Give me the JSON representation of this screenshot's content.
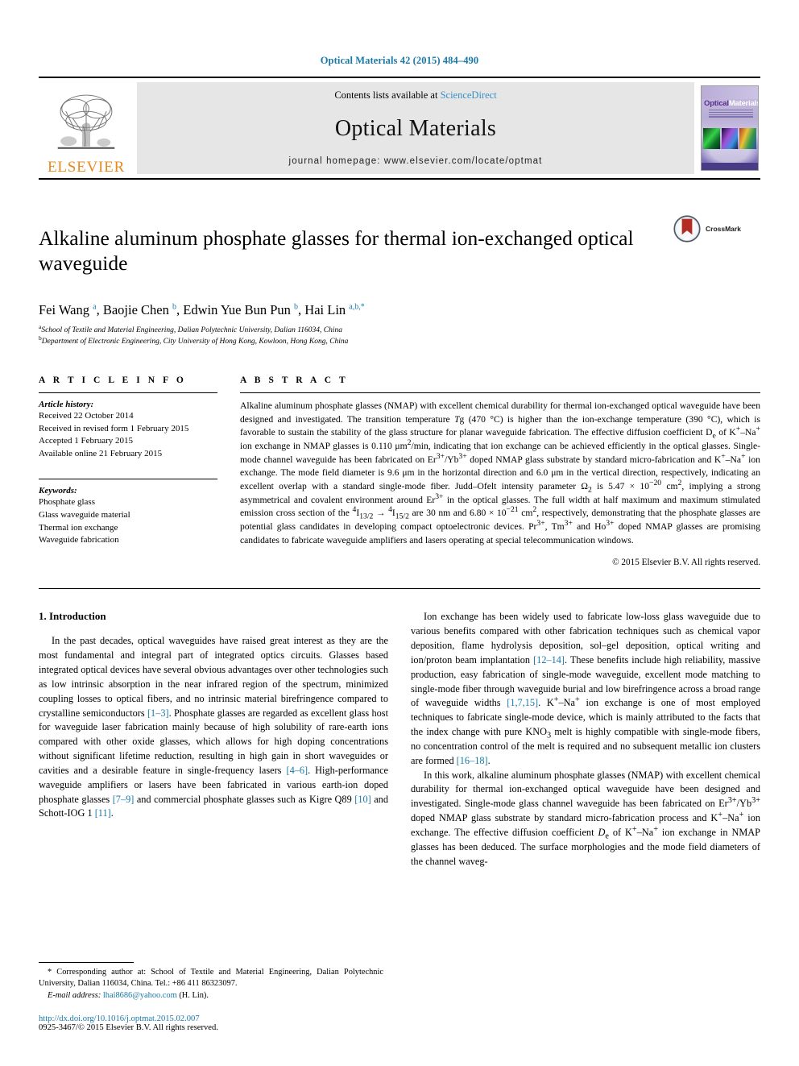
{
  "running_head": "Optical Materials 42 (2015) 484–490",
  "masthead": {
    "publisher_name": "ELSEVIER",
    "contents_prefix": "Contents lists available at ",
    "contents_link": "ScienceDirect",
    "journal_name": "Optical Materials",
    "homepage": "journal homepage: www.elsevier.com/locate/optmat",
    "cover": {
      "title_part1": "Optical",
      "title_part2": "Materials"
    }
  },
  "article": {
    "title": "Alkaline aluminum phosphate glasses for thermal ion-exchanged optical waveguide",
    "crossmark_label": "CrossMark",
    "authors_html": "Fei Wang <sup>a</sup>, Baojie Chen <sup>b</sup>, Edwin Yue Bun Pun <sup>b</sup>, Hai Lin <sup>a,b,</sup><sup>*</sup>",
    "affiliations": [
      "School of Textile and Material Engineering, Dalian Polytechnic University, Dalian 116034, China",
      "Department of Electronic Engineering, City University of Hong Kong, Kowloon, Hong Kong, China"
    ],
    "affiliation_marks": [
      "a",
      "b"
    ]
  },
  "info": {
    "heading": "A R T I C L E   I N F O",
    "history_label": "Article history:",
    "history": [
      "Received 22 October 2014",
      "Received in revised form 1 February 2015",
      "Accepted 1 February 2015",
      "Available online 21 February 2015"
    ],
    "keywords_label": "Keywords:",
    "keywords": [
      "Phosphate glass",
      "Glass waveguide material",
      "Thermal ion exchange",
      "Waveguide fabrication"
    ]
  },
  "abstract": {
    "heading": "A B S T R A C T",
    "body_html": "Alkaline aluminum phosphate glasses (NMAP) with excellent chemical durability for thermal ion-exchanged optical waveguide have been designed and investigated. The transition temperature <i>T</i>g (470&nbsp;°C) is higher than the ion-exchange temperature (390&nbsp;°C), which is favorable to sustain the stability of the glass structure for planar waveguide fabrication. The effective diffusion coefficient D<sub>e</sub> of K<sup>+</sup>–Na<sup>+</sup> ion exchange in NMAP glasses is 0.110 μm<sup>2</sup>/min, indicating that ion exchange can be achieved efficiently in the optical glasses. Single-mode channel waveguide has been fabricated on Er<sup>3+</sup>/Yb<sup>3+</sup> doped NMAP glass substrate by standard micro-fabrication and K<sup>+</sup>–Na<sup>+</sup> ion exchange. The mode field diameter is 9.6 μm in the horizontal direction and 6.0 μm in the vertical direction, respectively, indicating an excellent overlap with a standard single-mode fiber. Judd–Ofelt intensity parameter Ω<sub>2</sub> is 5.47 × 10<sup>−20</sup> cm<sup>2</sup>, implying a strong asymmetrical and covalent environment around Er<sup>3+</sup> in the optical glasses. The full width at half maximum and maximum stimulated emission cross section of the <sup>4</sup>I<sub>13/2</sub> → <sup>4</sup>I<sub>15/2</sub> are 30 nm and 6.80 × 10<sup>−21</sup> cm<sup>2</sup>, respectively, demonstrating that the phosphate glasses are potential glass candidates in developing compact optoelectronic devices. Pr<sup>3+</sup>, Tm<sup>3+</sup> and Ho<sup>3+</sup> doped NMAP glasses are promising candidates to fabricate waveguide amplifiers and lasers operating at special telecommunication windows.",
    "copyright": "© 2015 Elsevier B.V. All rights reserved."
  },
  "sections": {
    "intro_heading": "1. Introduction",
    "left_paragraphs_html": [
      "In the past decades, optical waveguides have raised great interest as they are the most fundamental and integral part of integrated optics circuits. Glasses based integrated optical devices have several obvious advantages over other technologies such as low intrinsic absorption in the near infrared region of the spectrum, minimized coupling losses to optical fibers, and no intrinsic material birefringence compared to crystalline semiconductors <span class=\"ref\">[1–3]</span>. Phosphate glasses are regarded as excellent glass host for waveguide laser fabrication mainly because of high solubility of rare-earth ions compared with other oxide glasses, which allows for high doping concentrations without significant lifetime reduction, resulting in high gain in short waveguides or cavities and a desirable feature in single-frequency lasers <span class=\"ref\">[4–6]</span>. High-performance waveguide amplifiers or lasers have been fabricated in various earth-ion doped phosphate glasses <span class=\"ref\">[7–9]</span> and commercial phosphate glasses such as Kigre Q89 <span class=\"ref\">[10]</span> and Schott-IOG 1 <span class=\"ref\">[11]</span>."
    ],
    "right_paragraphs_html": [
      "Ion exchange has been widely used to fabricate low-loss glass waveguide due to various benefits compared with other fabrication techniques such as chemical vapor deposition, flame hydrolysis deposition, sol–gel deposition, optical writing and ion/proton beam implantation <span class=\"ref\">[12–14]</span>. These benefits include high reliability, massive production, easy fabrication of single-mode waveguide, excellent mode matching to single-mode fiber through waveguide burial and low birefringence across a broad range of waveguide widths <span class=\"ref\">[1,7,15]</span>. K<sup>+</sup>–Na<sup>+</sup> ion exchange is one of most employed techniques to fabricate single-mode device, which is mainly attributed to the facts that the index change with pure KNO<sub>3</sub> melt is highly compatible with single-mode fibers, no concentration control of the melt is required and no subsequent metallic ion clusters are formed <span class=\"ref\">[16–18]</span>.",
      "In this work, alkaline aluminum phosphate glasses (NMAP) with excellent chemical durability for thermal ion-exchanged optical waveguide have been designed and investigated. Single-mode glass channel waveguide has been fabricated on Er<sup>3+</sup>/Yb<sup>3+</sup> doped NMAP glass substrate by standard micro-fabrication process and K<sup>+</sup>–Na<sup>+</sup> ion exchange. The effective diffusion coefficient <i>D</i><sub>e</sub> of K<sup>+</sup>–Na<sup>+</sup> ion exchange in NMAP glasses has been deduced. The surface morphologies and the mode field diameters of the channel waveg-"
    ]
  },
  "footnote": {
    "corresponding_html": "<span class=\"ind\">* Corresponding author at: School of Textile and Material Engineering, Dalian Polytechnic University, Dalian 116034, China. Tel.: +86 411 86323097.</span>",
    "email_label": "E-mail address:",
    "email": "lhai8686@yahoo.com",
    "email_suffix": "(H. Lin).",
    "doi": "http://dx.doi.org/10.1016/j.optmat.2015.02.007",
    "issn": "0925-3467/© 2015 Elsevier B.V. All rights reserved."
  },
  "colors": {
    "link": "#1879a8",
    "elsevier_orange": "#ea8a1e",
    "sciencedirect_blue": "#3a8fc4"
  }
}
